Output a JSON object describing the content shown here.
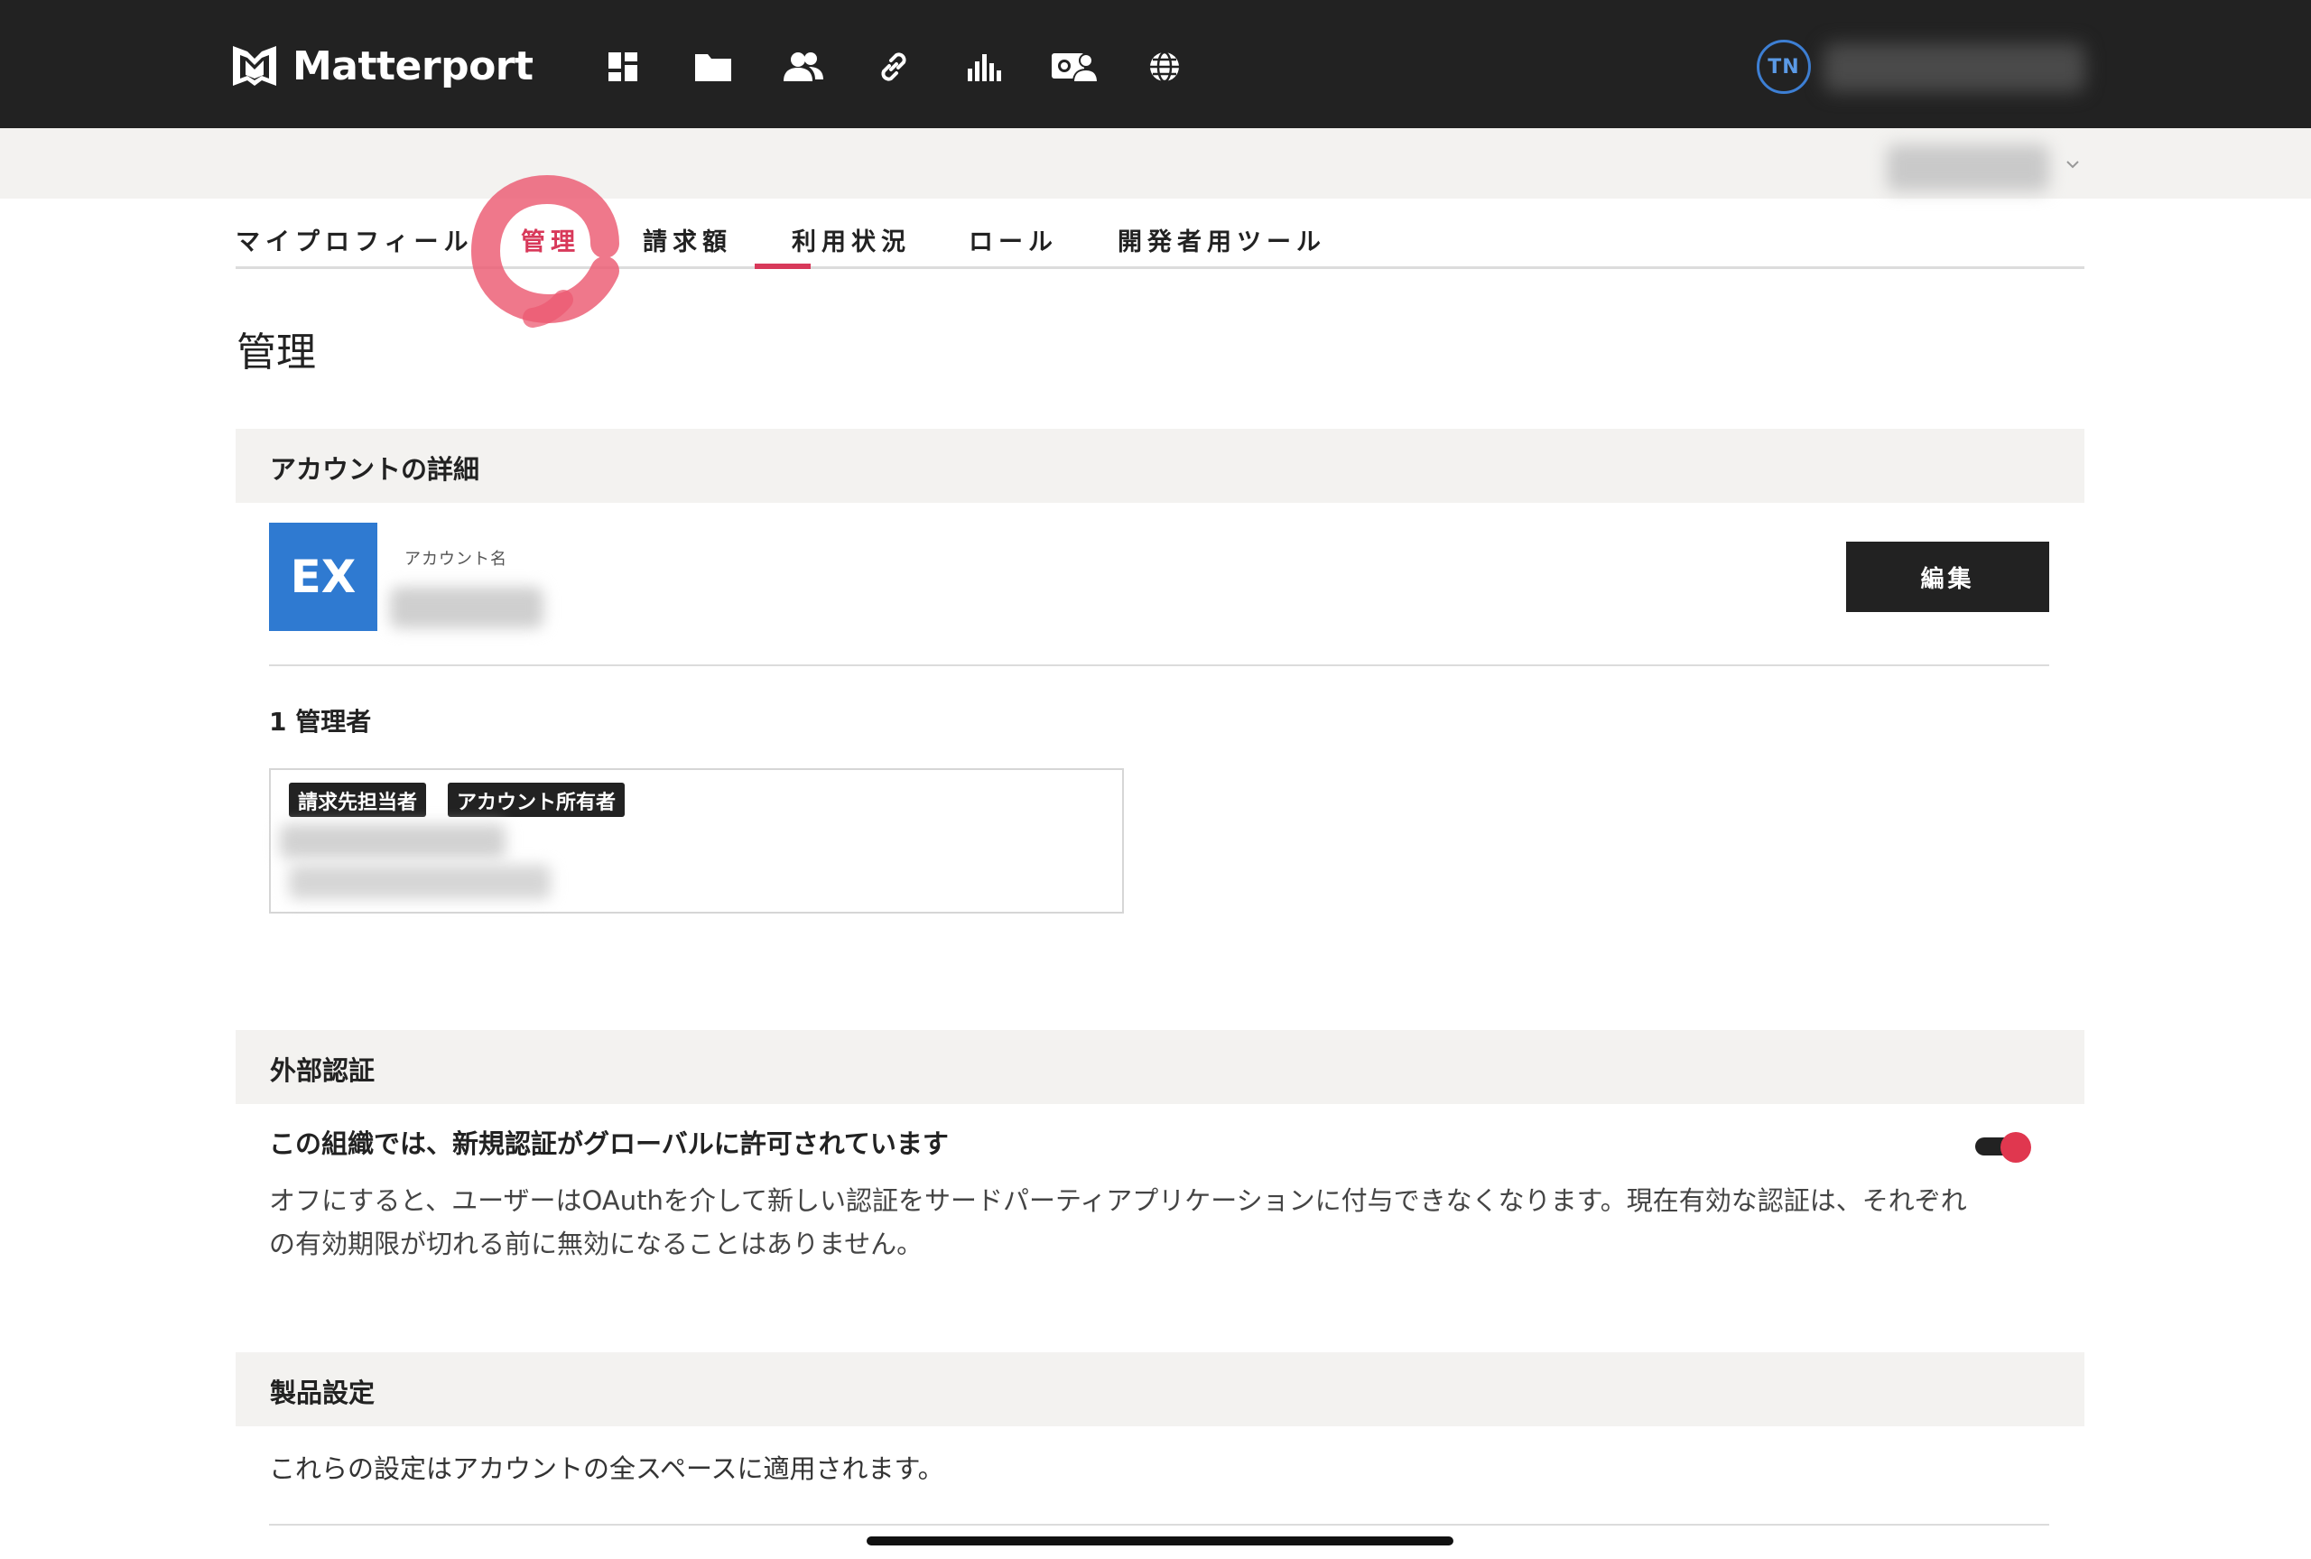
{
  "app": {
    "brand": "Matterport",
    "user_initials": "TN"
  },
  "nav_icons": [
    "dashboard-icon",
    "folder-icon",
    "users-icon",
    "link-icon",
    "bar-chart-icon",
    "photo-person-icon",
    "globe-icon"
  ],
  "tabs": [
    {
      "label": "マイプロフィール",
      "active": false
    },
    {
      "label": "管理",
      "active": true
    },
    {
      "label": "請求額",
      "active": false
    },
    {
      "label": "利用状況",
      "active": false
    },
    {
      "label": "ロール",
      "active": false
    },
    {
      "label": "開発者用ツール",
      "active": false
    }
  ],
  "page": {
    "title": "管理"
  },
  "account_details": {
    "header": "アカウントの詳細",
    "logo_text": "EX",
    "account_name_label": "アカウント名",
    "edit_label": "編集"
  },
  "admins": {
    "count_label": "1 管理者",
    "badges": [
      "請求先担当者",
      "アカウント所有者"
    ]
  },
  "external_auth": {
    "header": "外部認証",
    "title": "この組織では、新規認証がグローバルに許可されています",
    "description": "オフにすると、ユーザーはOAuthを介して新しい認証をサードパーティアプリケーションに付与できなくなります。現在有効な認証は、それぞれの有効期限が切れる前に無効になることはありません。",
    "toggle_on": true
  },
  "product_settings": {
    "header": "製品設定",
    "description": "これらの設定はアカウントの全スペースに適用されます。"
  },
  "colors": {
    "topbar": "#222222",
    "accent": "#d8395a",
    "account_logo": "#2f7ad1",
    "section_bg": "#f3f2f0"
  }
}
